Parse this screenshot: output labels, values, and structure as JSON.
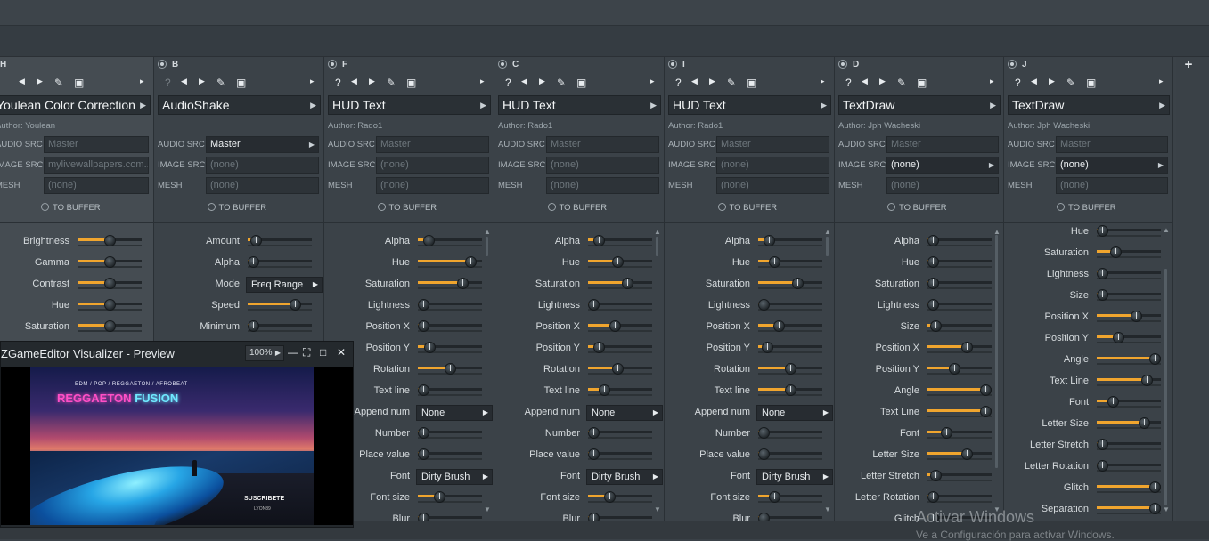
{
  "columns": [
    {
      "letter": "H",
      "name": "Youlean Color Correction",
      "author": "Author: Youlean",
      "srcs": [
        {
          "label": "AUDIO SRC",
          "value": "Master",
          "active": false
        },
        {
          "label": "IMAGE SRC",
          "value": "mylivewallpapers.com...",
          "active": false
        },
        {
          "label": "MESH",
          "value": "(none)",
          "active": false
        }
      ],
      "to_buffer": "TO BUFFER",
      "params": [
        {
          "label": "Brightness",
          "value": 0.5
        },
        {
          "label": "Gamma",
          "value": 0.5
        },
        {
          "label": "Contrast",
          "value": 0.5
        },
        {
          "label": "Hue",
          "value": 0.5
        },
        {
          "label": "Saturation",
          "value": 0.5
        }
      ]
    },
    {
      "letter": "B",
      "name": "AudioShake",
      "author": "",
      "srcs": [
        {
          "label": "AUDIO SRC",
          "value": "Master",
          "active": true
        },
        {
          "label": "IMAGE SRC",
          "value": "(none)",
          "active": false
        },
        {
          "label": "MESH",
          "value": "(none)",
          "active": false
        }
      ],
      "to_buffer": "TO BUFFER",
      "params": [
        {
          "label": "Amount",
          "value": 0.05
        },
        {
          "label": "Alpha",
          "value": 0.0
        },
        {
          "label": "Mode",
          "dropdown": "Freq Range"
        },
        {
          "label": "Speed",
          "value": 0.8
        },
        {
          "label": "Minimum",
          "value": 0.0
        }
      ]
    },
    {
      "letter": "F",
      "name": "HUD Text",
      "author": "Author: Rado1",
      "srcs": [
        {
          "label": "AUDIO SRC",
          "value": "Master",
          "active": false
        },
        {
          "label": "IMAGE SRC",
          "value": "(none)",
          "active": false
        },
        {
          "label": "MESH",
          "value": "(none)",
          "active": false
        }
      ],
      "to_buffer": "TO BUFFER",
      "params": [
        {
          "label": "Alpha",
          "value": 0.1
        },
        {
          "label": "Hue",
          "value": 0.9
        },
        {
          "label": "Saturation",
          "value": 0.75
        },
        {
          "label": "Lightness",
          "value": 0.0
        },
        {
          "label": "Position X",
          "value": 0.0
        },
        {
          "label": "Position Y",
          "value": 0.12
        },
        {
          "label": "Rotation",
          "value": 0.5
        },
        {
          "label": "Text line",
          "value": 0.0
        },
        {
          "label": "Append num",
          "dropdown": "None"
        },
        {
          "label": "Number",
          "value": 0.0
        },
        {
          "label": "Place value",
          "value": 0.0
        },
        {
          "label": "Font",
          "dropdown": "Dirty Brush",
          "nav": true
        },
        {
          "label": "Font size",
          "value": 0.3
        },
        {
          "label": "Blur",
          "value": 0.0
        }
      ]
    },
    {
      "letter": "C",
      "name": "HUD Text",
      "author": "Author: Rado1",
      "srcs": [
        {
          "label": "AUDIO SRC",
          "value": "Master",
          "active": false
        },
        {
          "label": "IMAGE SRC",
          "value": "(none)",
          "active": false
        },
        {
          "label": "MESH",
          "value": "(none)",
          "active": false
        }
      ],
      "to_buffer": "TO BUFFER",
      "params": [
        {
          "label": "Alpha",
          "value": 0.1
        },
        {
          "label": "Hue",
          "value": 0.45
        },
        {
          "label": "Saturation",
          "value": 0.65
        },
        {
          "label": "Lightness",
          "value": 0.0
        },
        {
          "label": "Position X",
          "value": 0.4
        },
        {
          "label": "Position Y",
          "value": 0.1
        },
        {
          "label": "Rotation",
          "value": 0.45
        },
        {
          "label": "Text line",
          "value": 0.2
        },
        {
          "label": "Append num",
          "dropdown": "None"
        },
        {
          "label": "Number",
          "value": 0.0
        },
        {
          "label": "Place value",
          "value": 0.0
        },
        {
          "label": "Font",
          "dropdown": "Dirty Brush",
          "nav": true
        },
        {
          "label": "Font size",
          "value": 0.3
        },
        {
          "label": "Blur",
          "value": 0.0
        }
      ]
    },
    {
      "letter": "I",
      "name": "HUD Text",
      "author": "Author: Rado1",
      "srcs": [
        {
          "label": "AUDIO SRC",
          "value": "Master",
          "active": false
        },
        {
          "label": "IMAGE SRC",
          "value": "(none)",
          "active": false
        },
        {
          "label": "MESH",
          "value": "(none)",
          "active": false
        }
      ],
      "to_buffer": "TO BUFFER",
      "params": [
        {
          "label": "Alpha",
          "value": 0.1
        },
        {
          "label": "Hue",
          "value": 0.2
        },
        {
          "label": "Saturation",
          "value": 0.65
        },
        {
          "label": "Lightness",
          "value": 0.0
        },
        {
          "label": "Position X",
          "value": 0.28
        },
        {
          "label": "Position Y",
          "value": 0.07
        },
        {
          "label": "Rotation",
          "value": 0.5
        },
        {
          "label": "Text line",
          "value": 0.5
        },
        {
          "label": "Append num",
          "dropdown": "None"
        },
        {
          "label": "Number",
          "value": 0.0
        },
        {
          "label": "Place value",
          "value": 0.0
        },
        {
          "label": "Font",
          "dropdown": "Dirty Brush",
          "nav": true
        },
        {
          "label": "Font size",
          "value": 0.2
        },
        {
          "label": "Blur",
          "value": 0.0
        }
      ]
    },
    {
      "letter": "D",
      "name": "TextDraw",
      "author": "Author: Jph Wacheski",
      "srcs": [
        {
          "label": "AUDIO SRC",
          "value": "Master",
          "active": false
        },
        {
          "label": "IMAGE SRC",
          "value": "(none)",
          "active": true
        },
        {
          "label": "MESH",
          "value": "(none)",
          "active": false
        }
      ],
      "to_buffer": "TO BUFFER",
      "params": [
        {
          "label": "Alpha",
          "value": 0.0
        },
        {
          "label": "Hue",
          "value": 0.0
        },
        {
          "label": "Saturation",
          "value": 0.0
        },
        {
          "label": "Lightness",
          "value": 0.0
        },
        {
          "label": "Size",
          "value": 0.05
        },
        {
          "label": "Position X",
          "value": 0.65
        },
        {
          "label": "Position Y",
          "value": 0.4
        },
        {
          "label": "Angle",
          "value": 1.0
        },
        {
          "label": "Text Line",
          "value": 1.0
        },
        {
          "label": "Font",
          "value": 0.25
        },
        {
          "label": "Letter Size",
          "value": 0.65
        },
        {
          "label": "Letter Stretch",
          "value": 0.05
        },
        {
          "label": "Letter Rotation",
          "value": 0.0
        },
        {
          "label": "Glitch",
          "value": 0.0
        }
      ]
    },
    {
      "letter": "J",
      "name": "TextDraw",
      "author": "Author: Jph Wacheski",
      "srcs": [
        {
          "label": "AUDIO SRC",
          "value": "Master",
          "active": false
        },
        {
          "label": "IMAGE SRC",
          "value": "(none)",
          "active": true
        },
        {
          "label": "MESH",
          "value": "(none)",
          "active": false
        }
      ],
      "to_buffer": "TO BUFFER",
      "params": [
        {
          "label": "Hue",
          "value": 0.0
        },
        {
          "label": "Saturation",
          "value": 0.25
        },
        {
          "label": "Lightness",
          "value": 0.0
        },
        {
          "label": "Size",
          "value": 0.0
        },
        {
          "label": "Position X",
          "value": 0.65
        },
        {
          "label": "Position Y",
          "value": 0.3
        },
        {
          "label": "Angle",
          "value": 1.0
        },
        {
          "label": "Text Line",
          "value": 0.85
        },
        {
          "label": "Font",
          "value": 0.2
        },
        {
          "label": "Letter Size",
          "value": 0.8
        },
        {
          "label": "Letter Stretch",
          "value": 0.0
        },
        {
          "label": "Letter Rotation",
          "value": 0.0
        },
        {
          "label": "Glitch",
          "value": 1.0
        },
        {
          "label": "Separation",
          "value": 1.0
        }
      ]
    }
  ],
  "add_button": "+",
  "preview": {
    "title": "ZGameEditor Visualizer - Preview",
    "zoom": "100%",
    "artwork_text": "EDM / POP / REGGAETON / AFROBEAT",
    "artwork_title_a": "REGGAETON",
    "artwork_title_b": "FUSION",
    "subscribe": "SUSCRIBETE",
    "subscribe_sub": "LYON89"
  },
  "watermark": {
    "line1": "Activar Windows",
    "line2": "Ve a Configuración para activar Windows."
  },
  "colors": {
    "accent": "#f0a52e",
    "panel": "#3b4248",
    "dark": "#2a3035"
  }
}
